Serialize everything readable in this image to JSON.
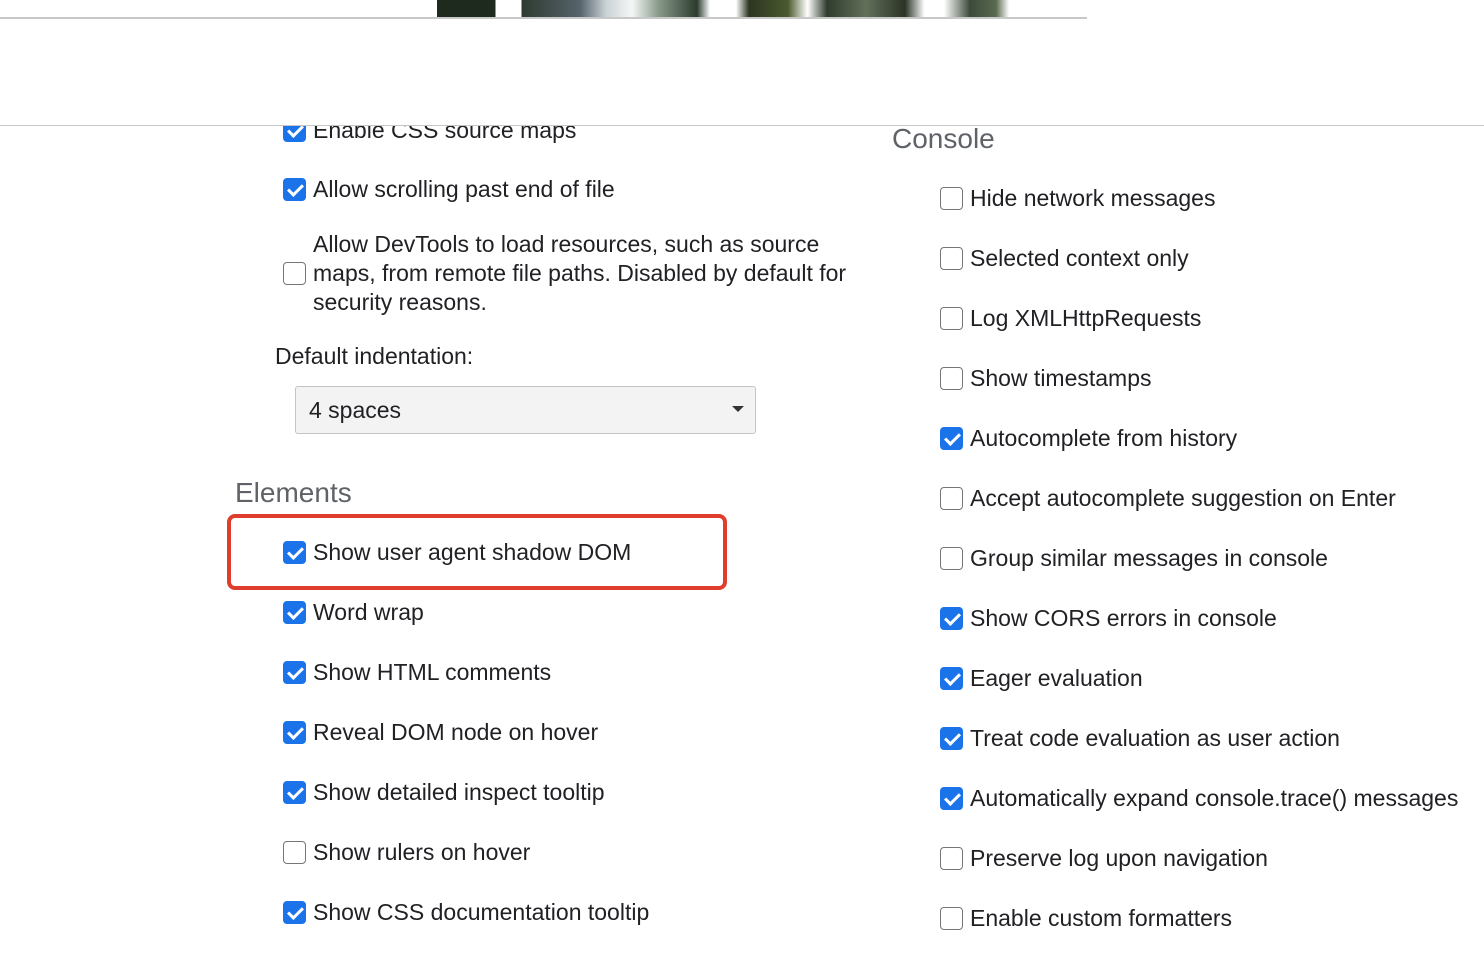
{
  "sources_partial": {
    "css_source_maps_label": "Enable CSS source maps",
    "css_source_maps_checked": true,
    "allow_scroll_label": "Allow scrolling past end of file",
    "allow_scroll_checked": true,
    "remote_paths_label": "Allow DevTools to load resources, such as source maps, from remote file paths. Disabled by default for security reasons.",
    "remote_paths_checked": false,
    "indentation_label": "Default indentation:",
    "indentation_value": "4 spaces"
  },
  "elements": {
    "title": "Elements",
    "items": [
      {
        "label": "Show user agent shadow DOM",
        "checked": true
      },
      {
        "label": "Word wrap",
        "checked": true
      },
      {
        "label": "Show HTML comments",
        "checked": true
      },
      {
        "label": "Reveal DOM node on hover",
        "checked": true
      },
      {
        "label": "Show detailed inspect tooltip",
        "checked": true
      },
      {
        "label": "Show rulers on hover",
        "checked": false
      },
      {
        "label": "Show CSS documentation tooltip",
        "checked": true
      }
    ]
  },
  "console": {
    "title": "Console",
    "items": [
      {
        "label": "Hide network messages",
        "checked": false
      },
      {
        "label": "Selected context only",
        "checked": false
      },
      {
        "label": "Log XMLHttpRequests",
        "checked": false
      },
      {
        "label": "Show timestamps",
        "checked": false
      },
      {
        "label": "Autocomplete from history",
        "checked": true
      },
      {
        "label": "Accept autocomplete suggestion on Enter",
        "checked": false
      },
      {
        "label": "Group similar messages in console",
        "checked": false
      },
      {
        "label": "Show CORS errors in console",
        "checked": true
      },
      {
        "label": "Eager evaluation",
        "checked": true
      },
      {
        "label": "Treat code evaluation as user action",
        "checked": true
      },
      {
        "label": "Automatically expand console.trace() messages",
        "checked": true
      },
      {
        "label": "Preserve log upon navigation",
        "checked": false
      },
      {
        "label": "Enable custom formatters",
        "checked": false
      }
    ]
  },
  "colors": {
    "checkbox_checked": "#1a73e8",
    "highlight": "#e03e2d",
    "section_title": "#5f6368"
  }
}
